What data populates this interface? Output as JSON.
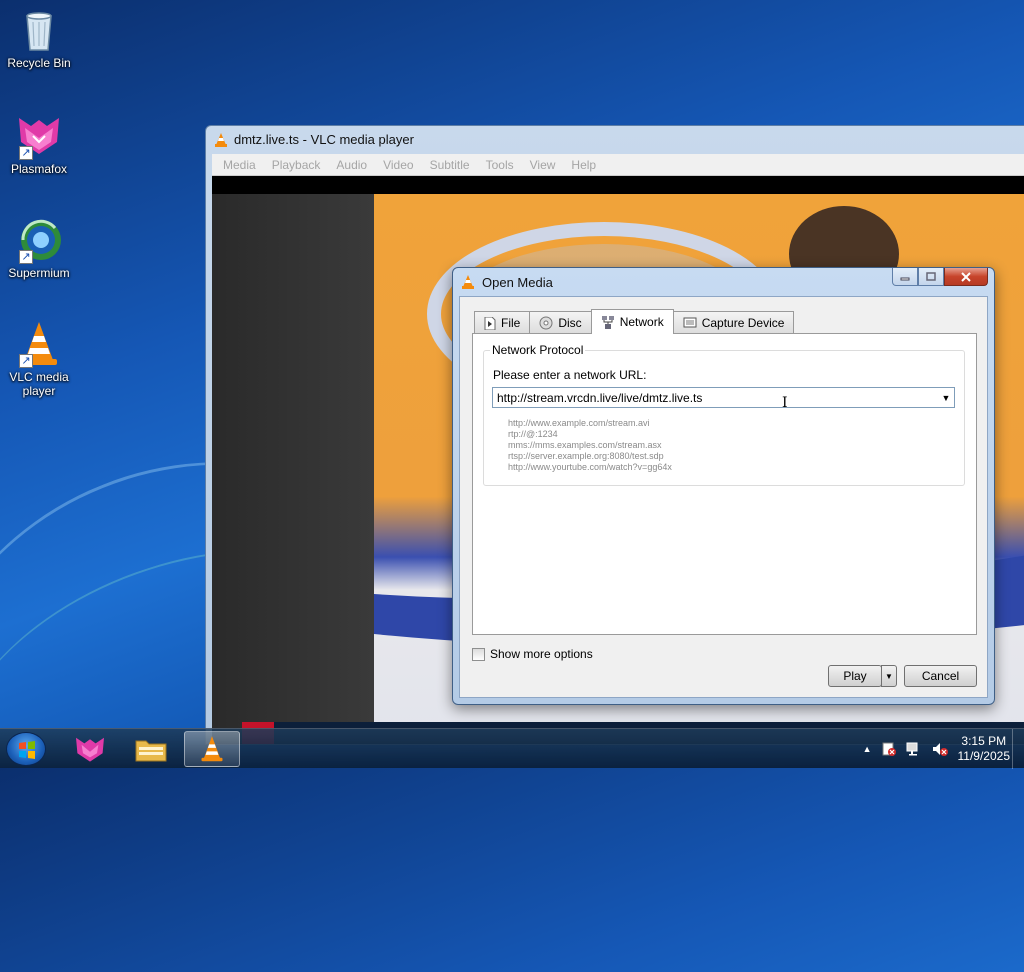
{
  "desktop": {
    "icons": [
      {
        "label": "Recycle Bin"
      },
      {
        "label": "Plasmafox"
      },
      {
        "label": "Supermium"
      },
      {
        "label": "VLC media player"
      }
    ]
  },
  "vlc_window": {
    "title": "dmtz.live.ts - VLC media player",
    "menu": [
      "Media",
      "Playback",
      "Audio",
      "Video",
      "Subtitle",
      "Tools",
      "View",
      "Help"
    ]
  },
  "open_media": {
    "title": "Open Media",
    "tabs": [
      {
        "label": "File",
        "icon": "file-icon"
      },
      {
        "label": "Disc",
        "icon": "disc-icon"
      },
      {
        "label": "Network",
        "icon": "network-icon",
        "active": true
      },
      {
        "label": "Capture Device",
        "icon": "capture-device-icon"
      }
    ],
    "group_title": "Network Protocol",
    "url_label": "Please enter a network URL:",
    "url_value": "http://stream.vrcdn.live/live/dmtz.live.ts",
    "examples": [
      "http://www.example.com/stream.avi",
      "rtp://@:1234",
      "mms://mms.examples.com/stream.asx",
      "rtsp://server.example.org:8080/test.sdp",
      "http://www.yourtube.com/watch?v=gg64x"
    ],
    "show_more_options": "Show more options",
    "play_label": "Play",
    "cancel_label": "Cancel"
  },
  "taskbar": {
    "time": "3:15 PM",
    "date": "11/9/2025"
  },
  "colors": {
    "accent": "#1d6fd1",
    "close_button": "#c7442b"
  }
}
